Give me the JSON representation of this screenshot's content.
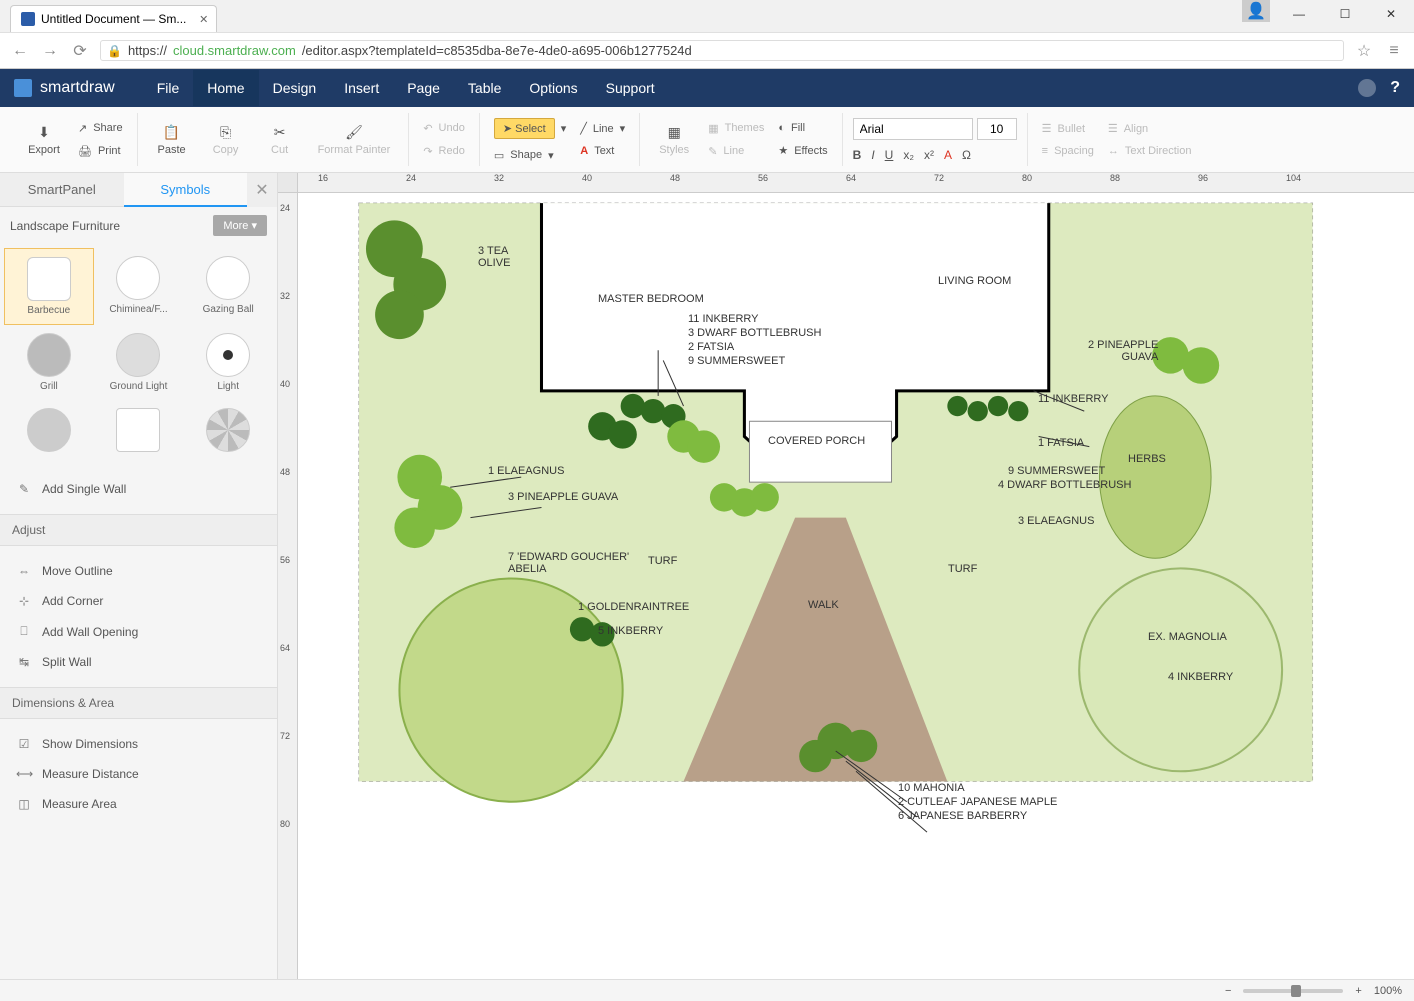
{
  "browser": {
    "tab_title": "Untitled Document — Sm...",
    "url_prefix": "https://",
    "url_domain": "cloud.smartdraw.com",
    "url_path": "/editor.aspx?templateId=c8535dba-8e7e-4de0-a695-006b1277524d"
  },
  "app": {
    "brand": "smartdraw",
    "menu": [
      "File",
      "Home",
      "Design",
      "Insert",
      "Page",
      "Table",
      "Options",
      "Support"
    ],
    "active_menu": "Home"
  },
  "ribbon": {
    "export": "Export",
    "share": "Share",
    "print": "Print",
    "paste": "Paste",
    "copy": "Copy",
    "cut": "Cut",
    "format_painter": "Format Painter",
    "undo": "Undo",
    "redo": "Redo",
    "select": "Select",
    "shape": "Shape",
    "line": "Line",
    "text": "Text",
    "styles": "Styles",
    "themes": "Themes",
    "line2": "Line",
    "fill": "Fill",
    "effects": "Effects",
    "font_name": "Arial",
    "font_size": "10",
    "bullet": "Bullet",
    "spacing": "Spacing",
    "align": "Align",
    "text_direction": "Text Direction"
  },
  "panel": {
    "tab_smartpanel": "SmartPanel",
    "tab_symbols": "Symbols",
    "category": "Landscape Furniture",
    "more": "More",
    "symbols": [
      {
        "label": "Barbecue",
        "selected": true
      },
      {
        "label": "Chiminea/F...",
        "selected": false
      },
      {
        "label": "Gazing Ball",
        "selected": false
      },
      {
        "label": "Grill",
        "selected": false
      },
      {
        "label": "Ground Light",
        "selected": false
      },
      {
        "label": "Light",
        "selected": false
      }
    ],
    "add_single_wall": "Add Single Wall",
    "adjust_title": "Adjust",
    "adjust_actions": [
      "Move Outline",
      "Add Corner",
      "Add Wall Opening",
      "Split Wall"
    ],
    "dimensions_title": "Dimensions & Area",
    "dimensions_actions": [
      "Show Dimensions",
      "Measure Distance",
      "Measure Area"
    ]
  },
  "ruler_h": [
    "16",
    "24",
    "32",
    "40",
    "48",
    "56",
    "64",
    "72",
    "80",
    "88",
    "96",
    "104"
  ],
  "ruler_v": [
    "24",
    "32",
    "40",
    "48",
    "56",
    "64",
    "72",
    "80"
  ],
  "plan": {
    "rooms": {
      "master_bedroom": "MASTER BEDROOM",
      "living_room": "LIVING ROOM",
      "covered_porch": "COVERED PORCH"
    },
    "areas": {
      "turf1": "TURF",
      "turf2": "TURF",
      "walk": "WALK",
      "herbs": "HERBS"
    },
    "plants": {
      "tea_olive": "3 TEA\nOLIVE",
      "inkberry11": "11 INKBERRY",
      "dwarf_bottlebrush3": "3 DWARF BOTTLEBRUSH",
      "fatsia2": "2 FATSIA",
      "summersweet9": "9 SUMMERSWEET",
      "pineapple_guava2": "2 PINEAPPLE\nGUAVA",
      "inkberry11b": "11 INKBERRY",
      "fatsia1": "1 FATSIA",
      "summersweet9b": "9 SUMMERSWEET",
      "dwarf_bottlebrush4": "4 DWARF BOTTLEBRUSH",
      "elaeagnus1": "1 ELAEAGNUS",
      "pineapple_guava3": "3 PINEAPPLE GUAVA",
      "edward_goucher": "7 'EDWARD GOUCHER'\nABELIA",
      "elaeagnus3": "3 ELAEAGNUS",
      "goldenraintree": "1 GOLDENRAINTREE",
      "inkberry5": "5 INKBERRY",
      "ex_magnolia": "EX. MAGNOLIA",
      "inkberry4": "4 INKBERRY",
      "mahonia": "10 MAHONIA",
      "cutleaf_maple": "2 CUTLEAF JAPANESE MAPLE",
      "japanese_barberry": "6 JAPANESE BARBERRY"
    }
  },
  "status": {
    "zoom": "100%"
  }
}
